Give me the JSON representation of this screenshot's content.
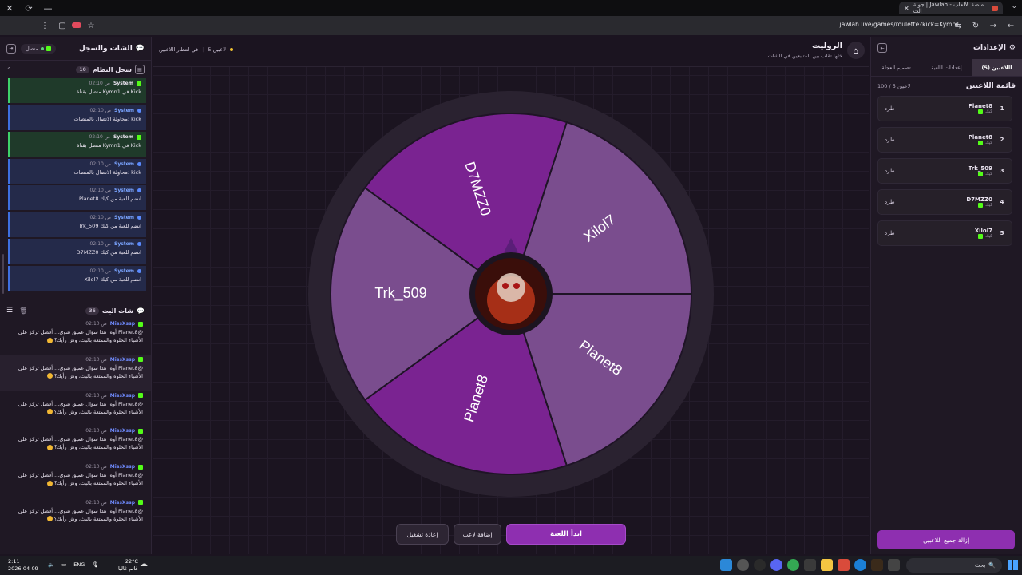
{
  "browser": {
    "tab_title": "جولة | Jawlah - منصة الألعاب الت",
    "url": "jawlah.live/games/roulette?kick=Kymn1"
  },
  "chat_panel": {
    "title": "الشات والسجل",
    "status": "متصل",
    "system_log": {
      "title": "سجل النظام",
      "count": "10",
      "items": [
        {
          "type": "ok",
          "name": "System",
          "time": "02:10 ص",
          "text": "متصل بقناة Kymn1 في Kick"
        },
        {
          "type": "info",
          "name": "System",
          "time": "02:10 ص",
          "text": "محاولة الاتصال بالمنصات: kick"
        },
        {
          "type": "ok",
          "name": "System",
          "time": "02:10 ص",
          "text": "متصل بقناة Kymn1 في Kick"
        },
        {
          "type": "info",
          "name": "System",
          "time": "02:10 ص",
          "text": "محاولة الاتصال بالمنصات: kick"
        },
        {
          "type": "info",
          "name": "System",
          "time": "02:10 ص",
          "text": "Planet8 انضم للعبة من كيك"
        },
        {
          "type": "info",
          "name": "System",
          "time": "02:10 ص",
          "text": "Trk_509 انضم للعبة من كيك"
        },
        {
          "type": "info",
          "name": "System",
          "time": "02:10 ص",
          "text": "D7MZZ0 انضم للعبة من كيك"
        },
        {
          "type": "info",
          "name": "System",
          "time": "02:10 ص",
          "text": "Xilol7 انضم للعبة من كيك"
        }
      ]
    },
    "live_chat": {
      "title": "شات البث",
      "count": "36",
      "messages": [
        {
          "user": "MissXssp",
          "time": "02:10 ص",
          "line1": "@Planet8 أوه، هذا سؤال عميق شوي... أفضل تركز على",
          "line2": "الأشياء الحلوة والممتعة بالبث، وش رأيك؟",
          "hl": false
        },
        {
          "user": "MissXssp",
          "time": "02:10 ص",
          "line1": "@Planet8 أوه، هذا سؤال عميق شوي... أفضل تركز على",
          "line2": "الأشياء الحلوة والممتعة بالبث، وش رأيك؟",
          "hl": true
        },
        {
          "user": "MissXssp",
          "time": "02:10 ص",
          "line1": "@Planet8 أوه، هذا سؤال عميق شوي... أفضل تركز على",
          "line2": "الأشياء الحلوة والممتعة بالبث، وش رأيك؟",
          "hl": false
        },
        {
          "user": "MissXssp",
          "time": "02:10 ص",
          "line1": "@Planet8 أوه، هذا سؤال عميق شوي... أفضل تركز على",
          "line2": "الأشياء الحلوة والممتعة بالبث، وش رأيك؟",
          "hl": false
        },
        {
          "user": "MissXssp",
          "time": "02:10 ص",
          "line1": "@Planet8 أوه، هذا سؤال عميق شوي... أفضل تركز على",
          "line2": "الأشياء الحلوة والممتعة بالبث، وش رأيك؟",
          "hl": false
        },
        {
          "user": "MissXssp",
          "time": "02:10 ص",
          "line1": "@Planet8 أوه، هذا سؤال عميق شوي... أفضل تركز على",
          "line2": "الأشياء الحلوة والممتعة بالبث، وش رأيك؟",
          "hl": false
        }
      ]
    }
  },
  "game": {
    "title": "الروليت",
    "subtitle": "خلها تقلب بين المتابعين في الشات",
    "players_count": "5 لاعبين",
    "waiting": "في انتظار اللاعبين",
    "wheel_segments": [
      {
        "label": "Xilol7",
        "color": "#7a4d8e"
      },
      {
        "label": "Planet8",
        "color": "#7a4d8e"
      },
      {
        "label": "Planet8",
        "color": "#7a2391"
      },
      {
        "label": "Trk_509",
        "color": "#7a4d8e"
      },
      {
        "label": "D7MZZ0",
        "color": "#7a2391"
      }
    ],
    "buttons": {
      "start": "ابدأ اللعبة",
      "add_player": "إضافة لاعب",
      "restart": "إعادة تشغيل"
    }
  },
  "settings": {
    "title": "الإعدادات",
    "tabs": [
      "اللاعبين (5)",
      "إعدادات اللعبة",
      "تصميم العجلة"
    ],
    "list_title": "قائمة اللاعبين",
    "list_count": "100 / 5 لاعبين",
    "source_label": "كيك",
    "kick_label": "طرد",
    "players": [
      {
        "idx": "1",
        "name": "Planet8"
      },
      {
        "idx": "2",
        "name": "Planet8"
      },
      {
        "idx": "3",
        "name": "Trk_509"
      },
      {
        "idx": "4",
        "name": "D7MZZ0"
      },
      {
        "idx": "5",
        "name": "Xilol7"
      }
    ],
    "remove_all": "إزالة جميع اللاعبين"
  },
  "taskbar": {
    "time": "2:11",
    "date": "2026-04-09",
    "lang": "ENG",
    "temp": "22°C",
    "weather": "غائم غالبا",
    "search": "بحث"
  },
  "colors": {
    "accent": "#8e2fb0",
    "kick_green": "#53fc18",
    "wheel_rim": "#2a2230"
  }
}
